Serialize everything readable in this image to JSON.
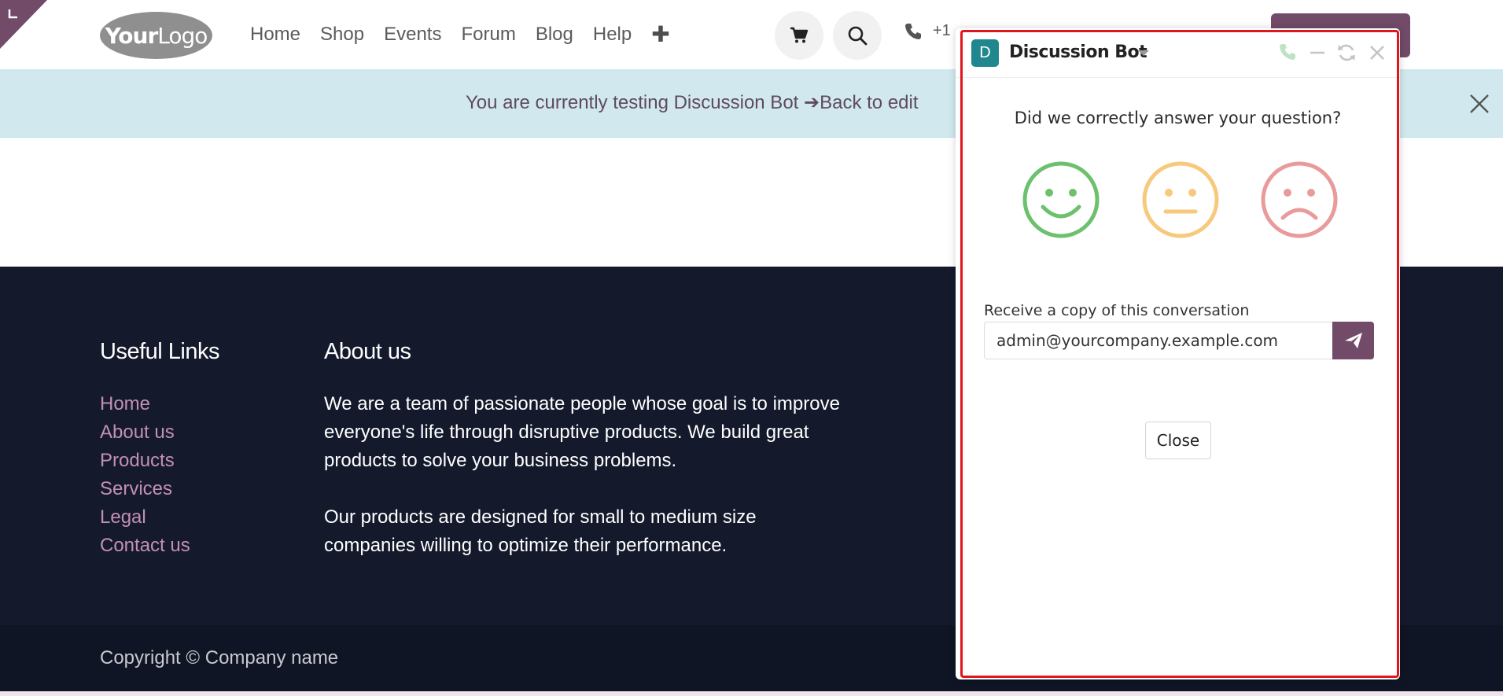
{
  "header": {
    "logo": {
      "bold": "Your",
      "normal": "Logo"
    },
    "nav": [
      "Home",
      "Shop",
      "Events",
      "Forum",
      "Blog",
      "Help"
    ],
    "plus": "✚",
    "phone_text": "+1"
  },
  "banner": {
    "text": "You are currently testing Discussion Bot ➔Back to edit"
  },
  "footer": {
    "useful_links_heading": "Useful Links",
    "useful_links": [
      "Home",
      "About us",
      "Products",
      "Services",
      "Legal",
      "Contact us"
    ],
    "about_heading": "About us",
    "about_text_1": "We are a team of passionate people whose goal is to improve everyone's life through disruptive products. We build great products to solve your business problems.",
    "about_text_2": "Our products are designed for small to medium size companies willing to optimize their performance.",
    "copyright": "Copyright © Company name"
  },
  "chat": {
    "avatar_letter": "D",
    "title": "Discussion Bot",
    "question": "Did we correctly answer your question?",
    "copy_label": "Receive a copy of this conversation",
    "email_value": "admin@yourcompany.example.com",
    "close_label": "Close"
  },
  "colors": {
    "brand": "#714b67",
    "footer_bg": "#141a2c",
    "banner_bg": "#d1e9ee",
    "link": "#c38fb6",
    "smile_green": "#6cc06e",
    "neutral_yellow": "#f7c97c",
    "sad_red": "#e99a9a",
    "highlight": "#e0161f"
  },
  "icons": {
    "cart": "cart-icon",
    "search": "search-icon",
    "phone": "phone-icon",
    "banner_close": "close-icon",
    "chat_call": "phone-icon",
    "chat_minimize": "minimize-icon",
    "chat_restart": "refresh-icon",
    "chat_close": "close-icon",
    "send": "paper-plane-icon"
  }
}
